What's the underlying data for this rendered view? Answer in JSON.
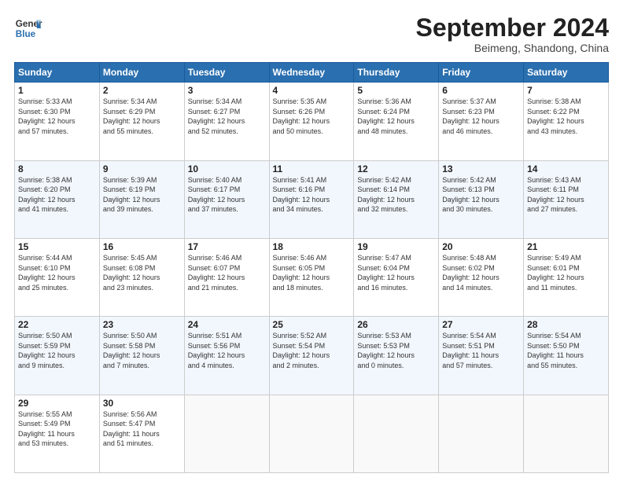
{
  "header": {
    "logo_line1": "General",
    "logo_line2": "Blue",
    "month": "September 2024",
    "location": "Beimeng, Shandong, China"
  },
  "weekdays": [
    "Sunday",
    "Monday",
    "Tuesday",
    "Wednesday",
    "Thursday",
    "Friday",
    "Saturday"
  ],
  "weeks": [
    [
      {
        "day": "1",
        "info": "Sunrise: 5:33 AM\nSunset: 6:30 PM\nDaylight: 12 hours\nand 57 minutes."
      },
      {
        "day": "2",
        "info": "Sunrise: 5:34 AM\nSunset: 6:29 PM\nDaylight: 12 hours\nand 55 minutes."
      },
      {
        "day": "3",
        "info": "Sunrise: 5:34 AM\nSunset: 6:27 PM\nDaylight: 12 hours\nand 52 minutes."
      },
      {
        "day": "4",
        "info": "Sunrise: 5:35 AM\nSunset: 6:26 PM\nDaylight: 12 hours\nand 50 minutes."
      },
      {
        "day": "5",
        "info": "Sunrise: 5:36 AM\nSunset: 6:24 PM\nDaylight: 12 hours\nand 48 minutes."
      },
      {
        "day": "6",
        "info": "Sunrise: 5:37 AM\nSunset: 6:23 PM\nDaylight: 12 hours\nand 46 minutes."
      },
      {
        "day": "7",
        "info": "Sunrise: 5:38 AM\nSunset: 6:22 PM\nDaylight: 12 hours\nand 43 minutes."
      }
    ],
    [
      {
        "day": "8",
        "info": "Sunrise: 5:38 AM\nSunset: 6:20 PM\nDaylight: 12 hours\nand 41 minutes."
      },
      {
        "day": "9",
        "info": "Sunrise: 5:39 AM\nSunset: 6:19 PM\nDaylight: 12 hours\nand 39 minutes."
      },
      {
        "day": "10",
        "info": "Sunrise: 5:40 AM\nSunset: 6:17 PM\nDaylight: 12 hours\nand 37 minutes."
      },
      {
        "day": "11",
        "info": "Sunrise: 5:41 AM\nSunset: 6:16 PM\nDaylight: 12 hours\nand 34 minutes."
      },
      {
        "day": "12",
        "info": "Sunrise: 5:42 AM\nSunset: 6:14 PM\nDaylight: 12 hours\nand 32 minutes."
      },
      {
        "day": "13",
        "info": "Sunrise: 5:42 AM\nSunset: 6:13 PM\nDaylight: 12 hours\nand 30 minutes."
      },
      {
        "day": "14",
        "info": "Sunrise: 5:43 AM\nSunset: 6:11 PM\nDaylight: 12 hours\nand 27 minutes."
      }
    ],
    [
      {
        "day": "15",
        "info": "Sunrise: 5:44 AM\nSunset: 6:10 PM\nDaylight: 12 hours\nand 25 minutes."
      },
      {
        "day": "16",
        "info": "Sunrise: 5:45 AM\nSunset: 6:08 PM\nDaylight: 12 hours\nand 23 minutes."
      },
      {
        "day": "17",
        "info": "Sunrise: 5:46 AM\nSunset: 6:07 PM\nDaylight: 12 hours\nand 21 minutes."
      },
      {
        "day": "18",
        "info": "Sunrise: 5:46 AM\nSunset: 6:05 PM\nDaylight: 12 hours\nand 18 minutes."
      },
      {
        "day": "19",
        "info": "Sunrise: 5:47 AM\nSunset: 6:04 PM\nDaylight: 12 hours\nand 16 minutes."
      },
      {
        "day": "20",
        "info": "Sunrise: 5:48 AM\nSunset: 6:02 PM\nDaylight: 12 hours\nand 14 minutes."
      },
      {
        "day": "21",
        "info": "Sunrise: 5:49 AM\nSunset: 6:01 PM\nDaylight: 12 hours\nand 11 minutes."
      }
    ],
    [
      {
        "day": "22",
        "info": "Sunrise: 5:50 AM\nSunset: 5:59 PM\nDaylight: 12 hours\nand 9 minutes."
      },
      {
        "day": "23",
        "info": "Sunrise: 5:50 AM\nSunset: 5:58 PM\nDaylight: 12 hours\nand 7 minutes."
      },
      {
        "day": "24",
        "info": "Sunrise: 5:51 AM\nSunset: 5:56 PM\nDaylight: 12 hours\nand 4 minutes."
      },
      {
        "day": "25",
        "info": "Sunrise: 5:52 AM\nSunset: 5:54 PM\nDaylight: 12 hours\nand 2 minutes."
      },
      {
        "day": "26",
        "info": "Sunrise: 5:53 AM\nSunset: 5:53 PM\nDaylight: 12 hours\nand 0 minutes."
      },
      {
        "day": "27",
        "info": "Sunrise: 5:54 AM\nSunset: 5:51 PM\nDaylight: 11 hours\nand 57 minutes."
      },
      {
        "day": "28",
        "info": "Sunrise: 5:54 AM\nSunset: 5:50 PM\nDaylight: 11 hours\nand 55 minutes."
      }
    ],
    [
      {
        "day": "29",
        "info": "Sunrise: 5:55 AM\nSunset: 5:49 PM\nDaylight: 11 hours\nand 53 minutes."
      },
      {
        "day": "30",
        "info": "Sunrise: 5:56 AM\nSunset: 5:47 PM\nDaylight: 11 hours\nand 51 minutes."
      },
      {
        "day": "",
        "info": ""
      },
      {
        "day": "",
        "info": ""
      },
      {
        "day": "",
        "info": ""
      },
      {
        "day": "",
        "info": ""
      },
      {
        "day": "",
        "info": ""
      }
    ]
  ]
}
